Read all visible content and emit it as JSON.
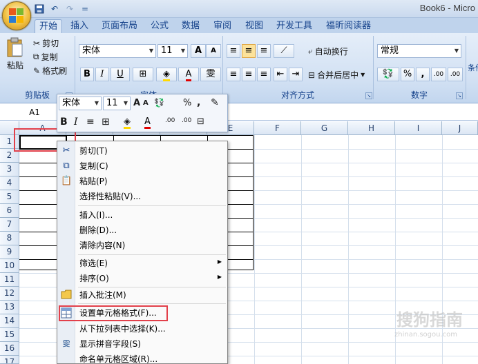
{
  "window": {
    "title": "Book6 - Micro",
    "qat": {
      "save_icon": "save-icon",
      "undo_icon": "undo-icon",
      "redo_icon": "redo-icon",
      "more": "="
    }
  },
  "tabs": [
    "开始",
    "插入",
    "页面布局",
    "公式",
    "数据",
    "审阅",
    "视图",
    "开发工具",
    "福昕阅读器"
  ],
  "ribbon": {
    "clipboard": {
      "paste": "粘贴",
      "cut": "剪切",
      "copy": "复制",
      "format_painter": "格式刷",
      "label": "剪贴板"
    },
    "font": {
      "name": "宋体",
      "size": "11",
      "bold": "B",
      "italic": "I",
      "underline": "U",
      "grow": "A",
      "shrink": "A",
      "wen": "雯",
      "label": "字体"
    },
    "alignment": {
      "wrap": "自动换行",
      "merge": "合并后居中",
      "label": "对齐方式"
    },
    "number": {
      "format": "常规",
      "percent": "%",
      "comma": ",",
      "inc_decimal": ".00",
      "dec_decimal": ".00",
      "label": "数字"
    },
    "cond_partial": "条件"
  },
  "formula_bar": {
    "namebox": "A1"
  },
  "grid": {
    "columns": [
      "A",
      "B",
      "C",
      "D",
      "E",
      "F",
      "G",
      "H",
      "I",
      "J"
    ],
    "rows": [
      "1",
      "2",
      "3",
      "4",
      "5",
      "6",
      "7",
      "8",
      "9",
      "10",
      "11",
      "12",
      "13",
      "14",
      "15",
      "16",
      "17"
    ]
  },
  "mini_toolbar": {
    "font": "宋体",
    "size": "11",
    "grow": "A",
    "shrink": "A",
    "percent": "%",
    "comma": ",",
    "bold": "B",
    "italic": "I",
    "font_color": "A",
    "inc_decimal": ".00",
    "dec_decimal": ".00"
  },
  "context_menu": {
    "items": [
      {
        "label": "剪切(T)",
        "icon": "scissors-icon"
      },
      {
        "label": "复制(C)",
        "icon": "copy-icon"
      },
      {
        "label": "粘贴(P)",
        "icon": "paste-icon"
      },
      {
        "label": "选择性粘贴(V)..."
      },
      {
        "label": "插入(I)..."
      },
      {
        "label": "删除(D)..."
      },
      {
        "label": "清除内容(N)"
      },
      {
        "label": "筛选(E)",
        "submenu": true
      },
      {
        "label": "排序(O)",
        "submenu": true
      },
      {
        "label": "插入批注(M)",
        "icon": "comment-icon"
      },
      {
        "label": "设置单元格格式(F)...",
        "icon": "format-cells-icon"
      },
      {
        "label": "从下拉列表中选择(K)..."
      },
      {
        "label": "显示拼音字段(S)",
        "icon": "phonetic-icon",
        "icon_glyph": "雯"
      },
      {
        "label": "命名单元格区域(R)..."
      }
    ]
  },
  "colors": {
    "accent": "#15428b",
    "highlight": "#e2404a",
    "ribbon_bg": "#d1e0f3"
  },
  "watermark": {
    "text": "搜狗指南",
    "url": "zhinan.sogou.com"
  }
}
